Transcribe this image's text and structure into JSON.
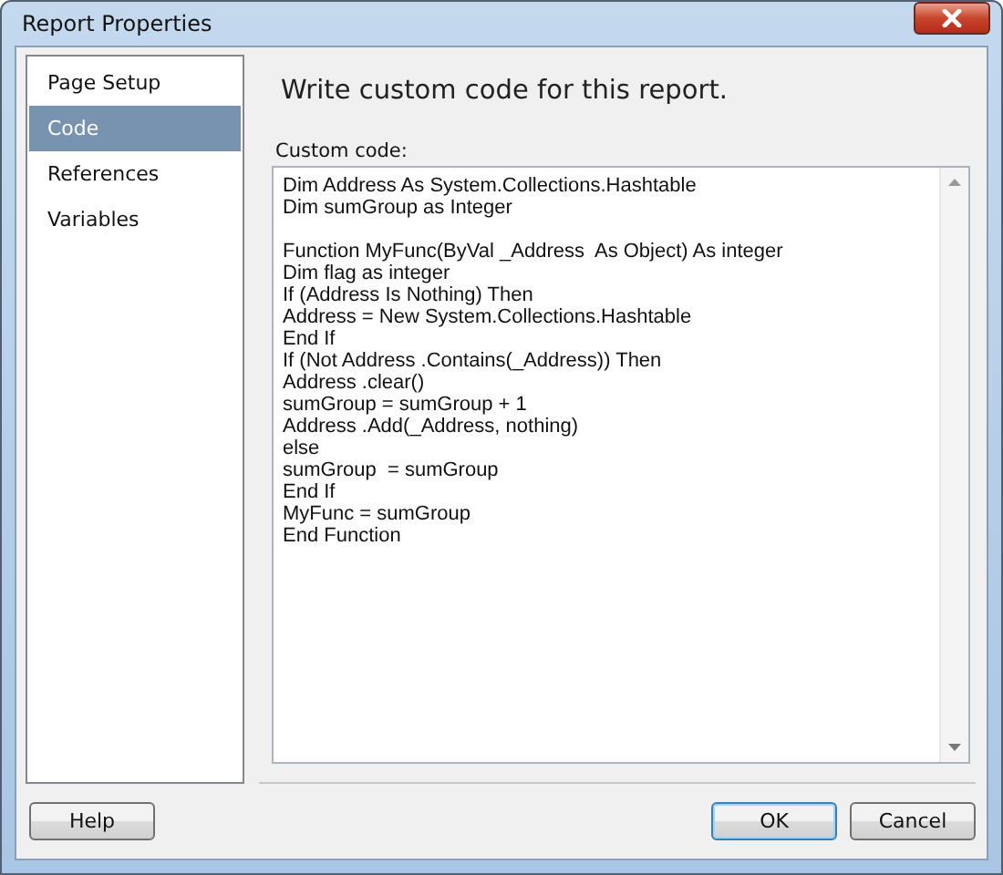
{
  "window": {
    "title": "Report Properties"
  },
  "sidebar": {
    "items": [
      {
        "label": "Page Setup",
        "selected": false
      },
      {
        "label": "Code",
        "selected": true
      },
      {
        "label": "References",
        "selected": false
      },
      {
        "label": "Variables",
        "selected": false
      }
    ]
  },
  "heading": "Write custom code for this report.",
  "custom_code": {
    "label": "Custom code:",
    "value": "Dim Address As System.Collections.Hashtable\nDim sumGroup as Integer\n\nFunction MyFunc(ByVal _Address  As Object) As integer\nDim flag as integer\nIf (Address Is Nothing) Then\nAddress = New System.Collections.Hashtable\nEnd If\nIf (Not Address .Contains(_Address)) Then\nAddress .clear()\nsumGroup = sumGroup + 1\nAddress .Add(_Address, nothing)\nelse\nsumGroup  = sumGroup\nEnd If\nMyFunc = sumGroup\nEnd Function"
  },
  "buttons": [
    {
      "label": "Help",
      "kind": "help"
    },
    {
      "label": "OK",
      "kind": "default"
    },
    {
      "label": "Cancel",
      "kind": "normal"
    }
  ]
}
